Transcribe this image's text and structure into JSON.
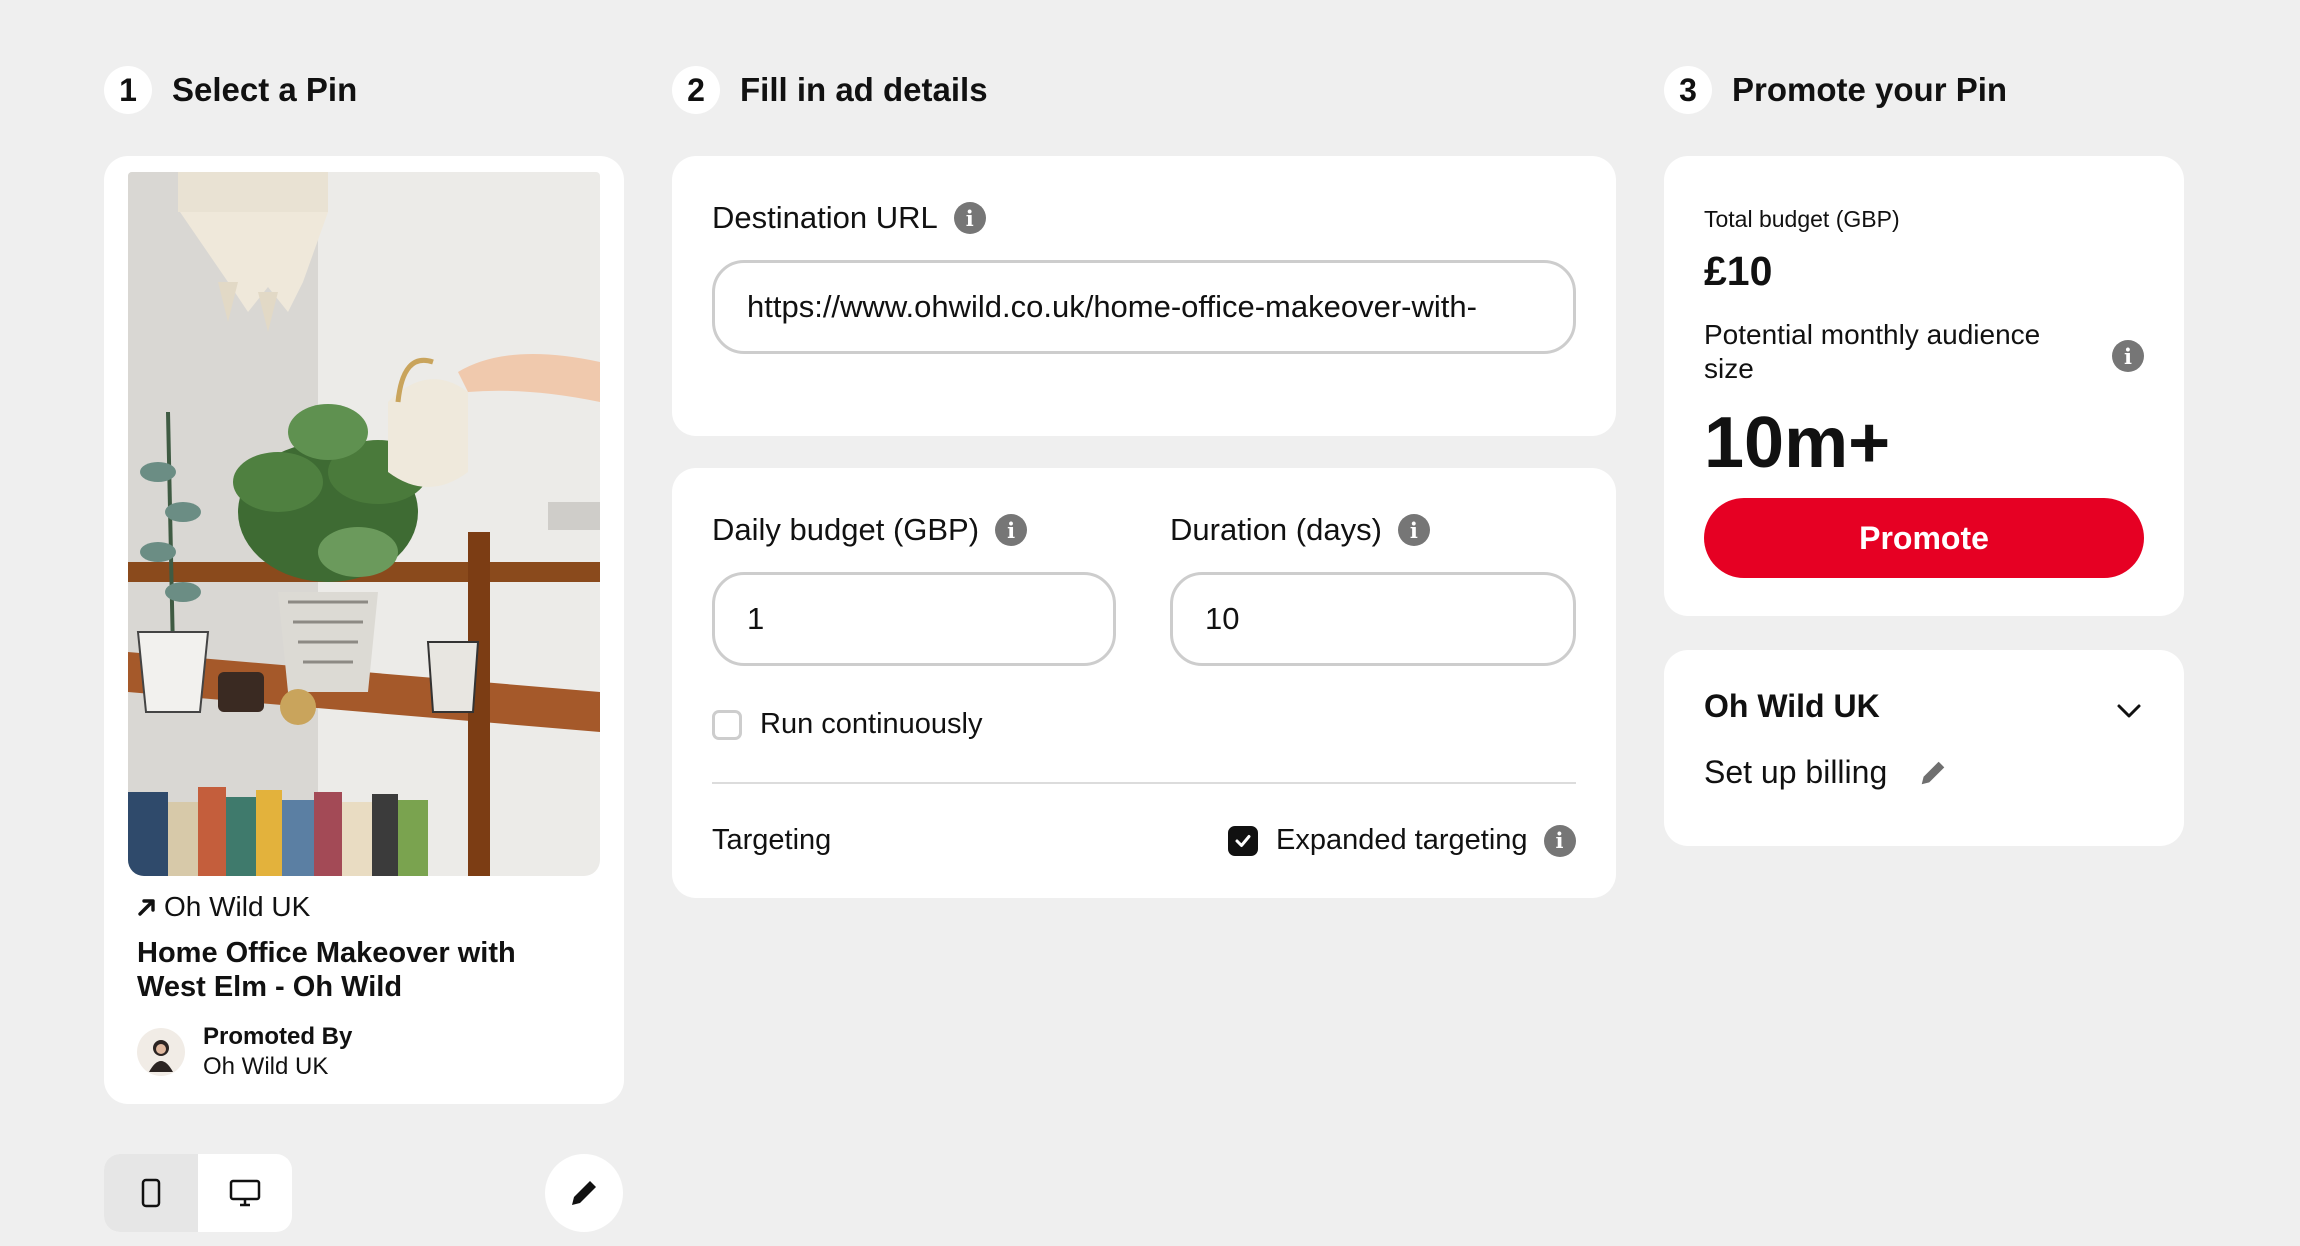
{
  "steps": [
    {
      "number": "1",
      "title": "Select a Pin"
    },
    {
      "number": "2",
      "title": "Fill in ad details"
    },
    {
      "number": "3",
      "title": "Promote your Pin"
    }
  ],
  "pin": {
    "source": "Oh Wild UK",
    "title": "Home Office Makeover with West Elm - Oh Wild",
    "promoted_by_label": "Promoted By",
    "promoted_by_name": "Oh Wild UK"
  },
  "ad_details": {
    "destination_url_label": "Destination URL",
    "destination_url_value": "https://www.ohwild.co.uk/home-office-makeover-with-",
    "daily_budget_label": "Daily budget (GBP)",
    "daily_budget_value": "1",
    "duration_label": "Duration (days)",
    "duration_value": "10",
    "run_continuously_label": "Run continuously",
    "run_continuously_checked": false,
    "targeting_label": "Targeting",
    "expanded_targeting_label": "Expanded targeting",
    "expanded_targeting_checked": true
  },
  "promote": {
    "total_budget_label": "Total budget (GBP)",
    "total_budget_value": "£10",
    "audience_label": "Potential monthly audience size",
    "audience_value": "10m+",
    "promote_button": "Promote"
  },
  "account": {
    "name": "Oh Wild UK",
    "billing_label": "Set up billing"
  },
  "icons": {
    "info": "info-icon",
    "pencil": "pencil-icon",
    "chevron": "chevron-down-icon",
    "arrow": "arrow-up-right-icon",
    "mobile": "mobile-icon",
    "desktop": "desktop-icon"
  },
  "colors": {
    "background": "#efefef",
    "accent": "#e60023",
    "info_icon": "#767676"
  }
}
